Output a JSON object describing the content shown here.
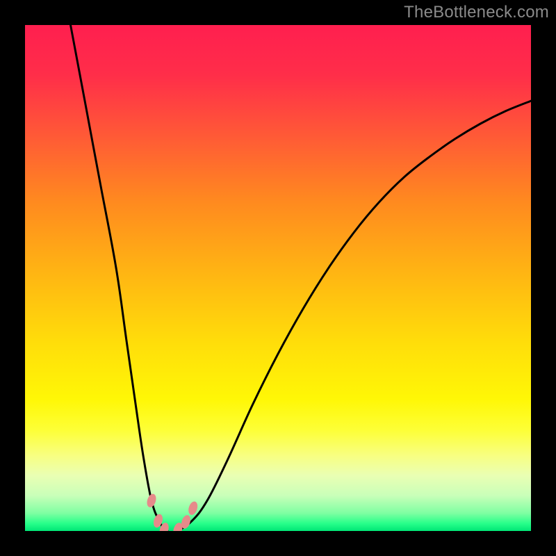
{
  "watermark": {
    "text": "TheBottleneck.com"
  },
  "gradient": {
    "stops": [
      {
        "offset": 0.0,
        "color": "#ff1f4f"
      },
      {
        "offset": 0.1,
        "color": "#ff2e49"
      },
      {
        "offset": 0.22,
        "color": "#ff5a36"
      },
      {
        "offset": 0.35,
        "color": "#ff8a1f"
      },
      {
        "offset": 0.5,
        "color": "#ffb812"
      },
      {
        "offset": 0.63,
        "color": "#ffde0a"
      },
      {
        "offset": 0.74,
        "color": "#fff706"
      },
      {
        "offset": 0.8,
        "color": "#fdff36"
      },
      {
        "offset": 0.85,
        "color": "#f8ff80"
      },
      {
        "offset": 0.89,
        "color": "#eaffb3"
      },
      {
        "offset": 0.93,
        "color": "#c9ffb9"
      },
      {
        "offset": 0.965,
        "color": "#7effa2"
      },
      {
        "offset": 0.985,
        "color": "#28ff8a"
      },
      {
        "offset": 1.0,
        "color": "#00e676"
      }
    ]
  },
  "chart_data": {
    "type": "line",
    "title": "",
    "xlabel": "",
    "ylabel": "",
    "xlim": [
      0,
      100
    ],
    "ylim": [
      0,
      100
    ],
    "series": [
      {
        "name": "fit-curve",
        "x": [
          9,
          12,
          15,
          18,
          20,
          22,
          23.5,
          25,
          26.5,
          28,
          30,
          33,
          36,
          40,
          45,
          50,
          55,
          60,
          65,
          70,
          75,
          80,
          85,
          90,
          95,
          100
        ],
        "y": [
          100,
          84,
          68,
          52,
          38,
          24,
          14,
          6,
          2,
          0,
          0,
          2,
          6,
          14,
          25,
          35,
          44,
          52,
          59,
          65,
          70,
          74,
          77.5,
          80.5,
          83,
          85
        ]
      }
    ],
    "flat_region": {
      "x_start": 26.5,
      "x_end": 30,
      "y": 0
    },
    "markers": [
      {
        "x": 25.0,
        "y": 6.0
      },
      {
        "x": 26.3,
        "y": 2.0
      },
      {
        "x": 27.5,
        "y": 0.3
      },
      {
        "x": 30.2,
        "y": 0.3
      },
      {
        "x": 31.8,
        "y": 1.8
      },
      {
        "x": 33.2,
        "y": 4.5
      }
    ],
    "marker_style": {
      "color": "#e68a8a",
      "rx": 6,
      "ry": 10,
      "rotation_deg": 18
    }
  }
}
